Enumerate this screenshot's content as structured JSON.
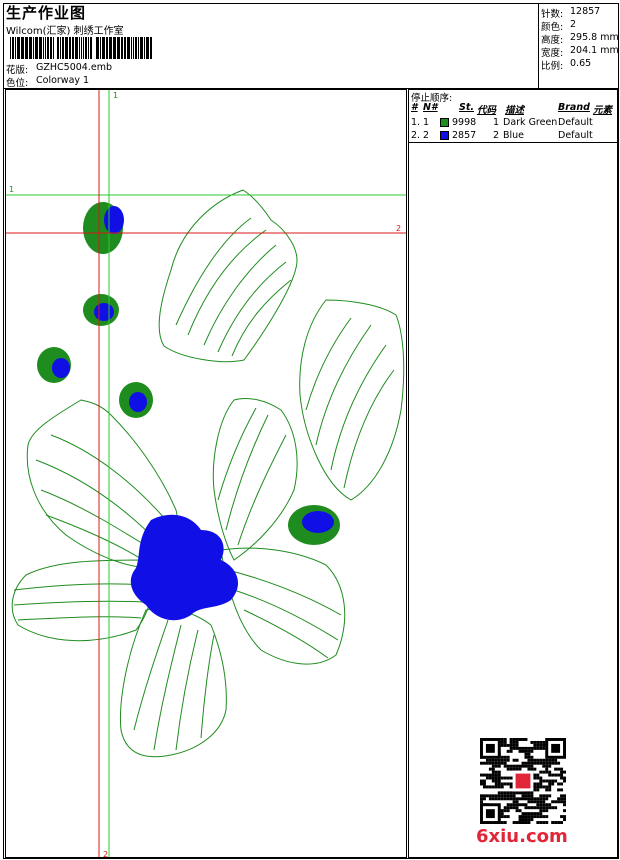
{
  "header": {
    "title": "生产作业图",
    "studio": "Wilcom(汇家) 刺绣工作室",
    "design_label": "花版:",
    "design_file": "GZHC5004.emb",
    "colorway_label": "色位:",
    "colorway": "Colorway 1"
  },
  "stats": {
    "stitches_label": "针数:",
    "stitches": "12857",
    "colors_label": "颜色:",
    "colors": "2",
    "height_label": "高度:",
    "height": "295.8 mm",
    "width_label": "宽度:",
    "width": "204.1 mm",
    "scale_label": "比例:",
    "scale": "0.65"
  },
  "stop_sequence": {
    "title": "停止顺序:",
    "columns": [
      "#",
      "N#",
      "St.",
      "代码",
      "描述",
      "Brand",
      "元素"
    ],
    "rows": [
      {
        "index": "1.",
        "needle": "1",
        "color": "#1f8c1f",
        "stitch": "9998",
        "code": "1",
        "desc": "Dark Green",
        "brand": "Default"
      },
      {
        "index": "2.",
        "needle": "2",
        "color": "#1010e6",
        "stitch": "2857",
        "code": "2",
        "desc": "Blue",
        "brand": "Default"
      }
    ]
  },
  "guides": {
    "green_v_label": "1",
    "green_h_label": "1",
    "red_h_label": "2",
    "red_v_label": "2"
  },
  "colors": {
    "green_thread": "#1f8c1f",
    "blue_thread": "#1010e6",
    "guide_green": "#2ec82e",
    "guide_red": "#d81818",
    "watermark": "#e2263a"
  },
  "watermark": "6xiu.com"
}
